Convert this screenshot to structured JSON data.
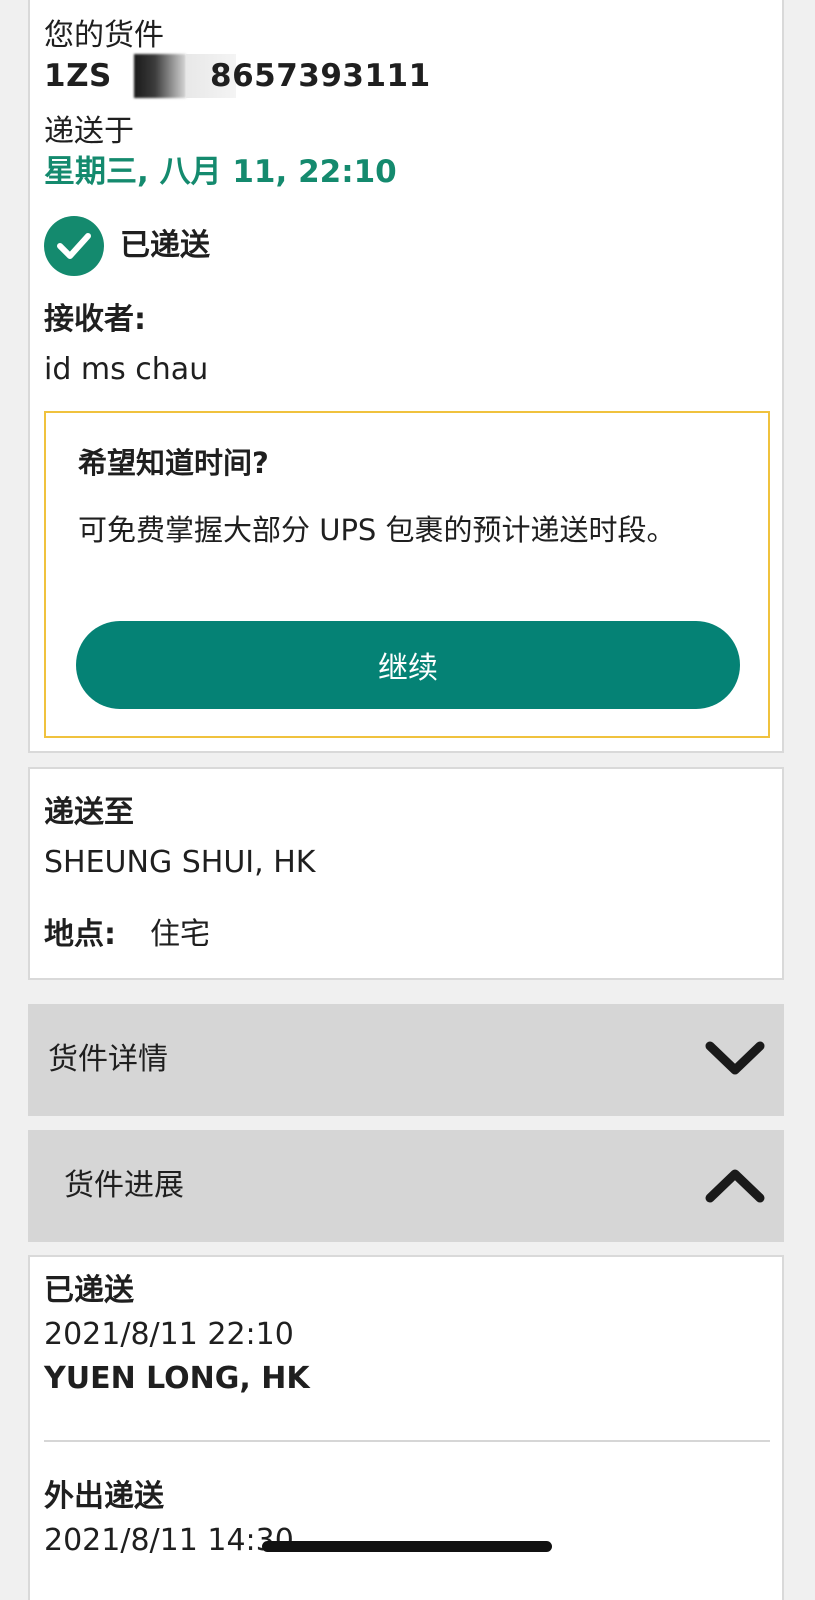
{
  "shipment": {
    "heading": "您的货件",
    "tracking_prefix": "1ZS",
    "tracking_suffix": "8657393111",
    "delivered_on_label": "递送于",
    "delivered_on_value": "星期三, 八月 11, 22:10",
    "status": "已递送",
    "receiver_label": "接收者:",
    "receiver_value": "id ms chau"
  },
  "promo": {
    "title": "希望知道时间?",
    "text": "可免费掌握大部分 UPS 包裹的预计递送时段。",
    "button_label": "继续"
  },
  "destination": {
    "label": "递送至",
    "value": "SHEUNG SHUI, HK",
    "location_label": "地点:",
    "location_value": "住宅"
  },
  "accordions": {
    "details_label": "货件详情",
    "details_icon": "chevron-down-icon",
    "progress_label": "货件进展",
    "progress_icon": "chevron-up-icon"
  },
  "progress": [
    {
      "status": "已递送",
      "datetime": "2021/8/11 22:10",
      "location": "YUEN LONG, HK"
    },
    {
      "status": "外出递送",
      "datetime": "2021/8/11 14:30"
    }
  ],
  "colors": {
    "brand_teal": "#058275",
    "date_teal": "#148a6e",
    "promo_border": "#f0c23e",
    "accordion_bg": "#d6d6d6"
  }
}
